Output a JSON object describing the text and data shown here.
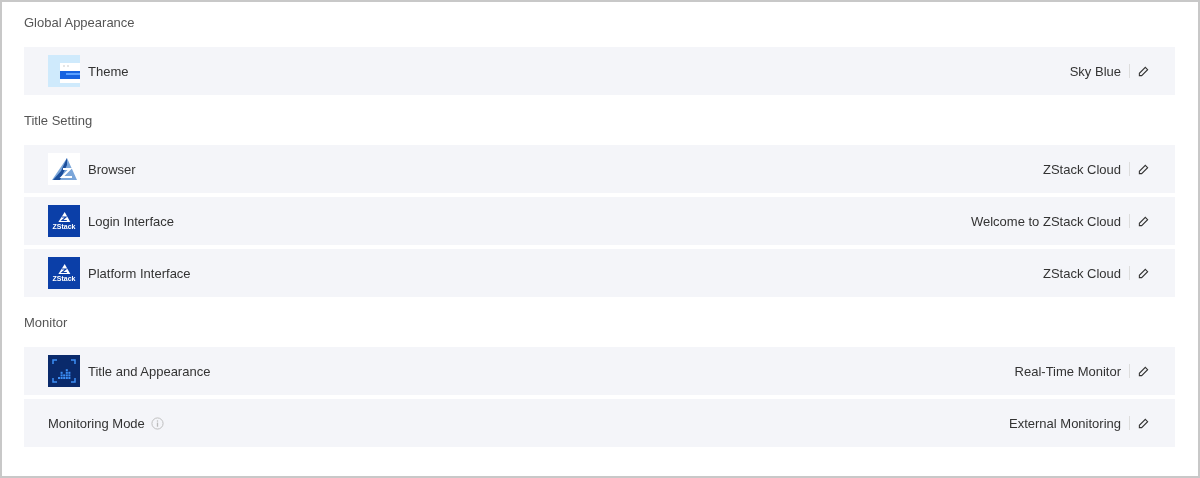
{
  "sections": [
    {
      "title": "Global Appearance",
      "rows": [
        {
          "kind": "theme",
          "label": "Theme",
          "value": "Sky Blue"
        }
      ]
    },
    {
      "title": "Title Setting",
      "rows": [
        {
          "kind": "browser",
          "label": "Browser",
          "value": "ZStack Cloud"
        },
        {
          "kind": "logo",
          "logo_text": "ZStack",
          "label": "Login Interface",
          "value": "Welcome to ZStack Cloud"
        },
        {
          "kind": "logo",
          "logo_text": "ZStack",
          "label": "Platform Interface",
          "value": "ZStack Cloud"
        }
      ]
    },
    {
      "title": "Monitor",
      "rows": [
        {
          "kind": "monitor",
          "label": "Title and Appearance",
          "value": "Real-Time Monitor"
        },
        {
          "label": "Monitoring Mode",
          "info": true,
          "value": "External Monitoring"
        }
      ]
    }
  ]
}
